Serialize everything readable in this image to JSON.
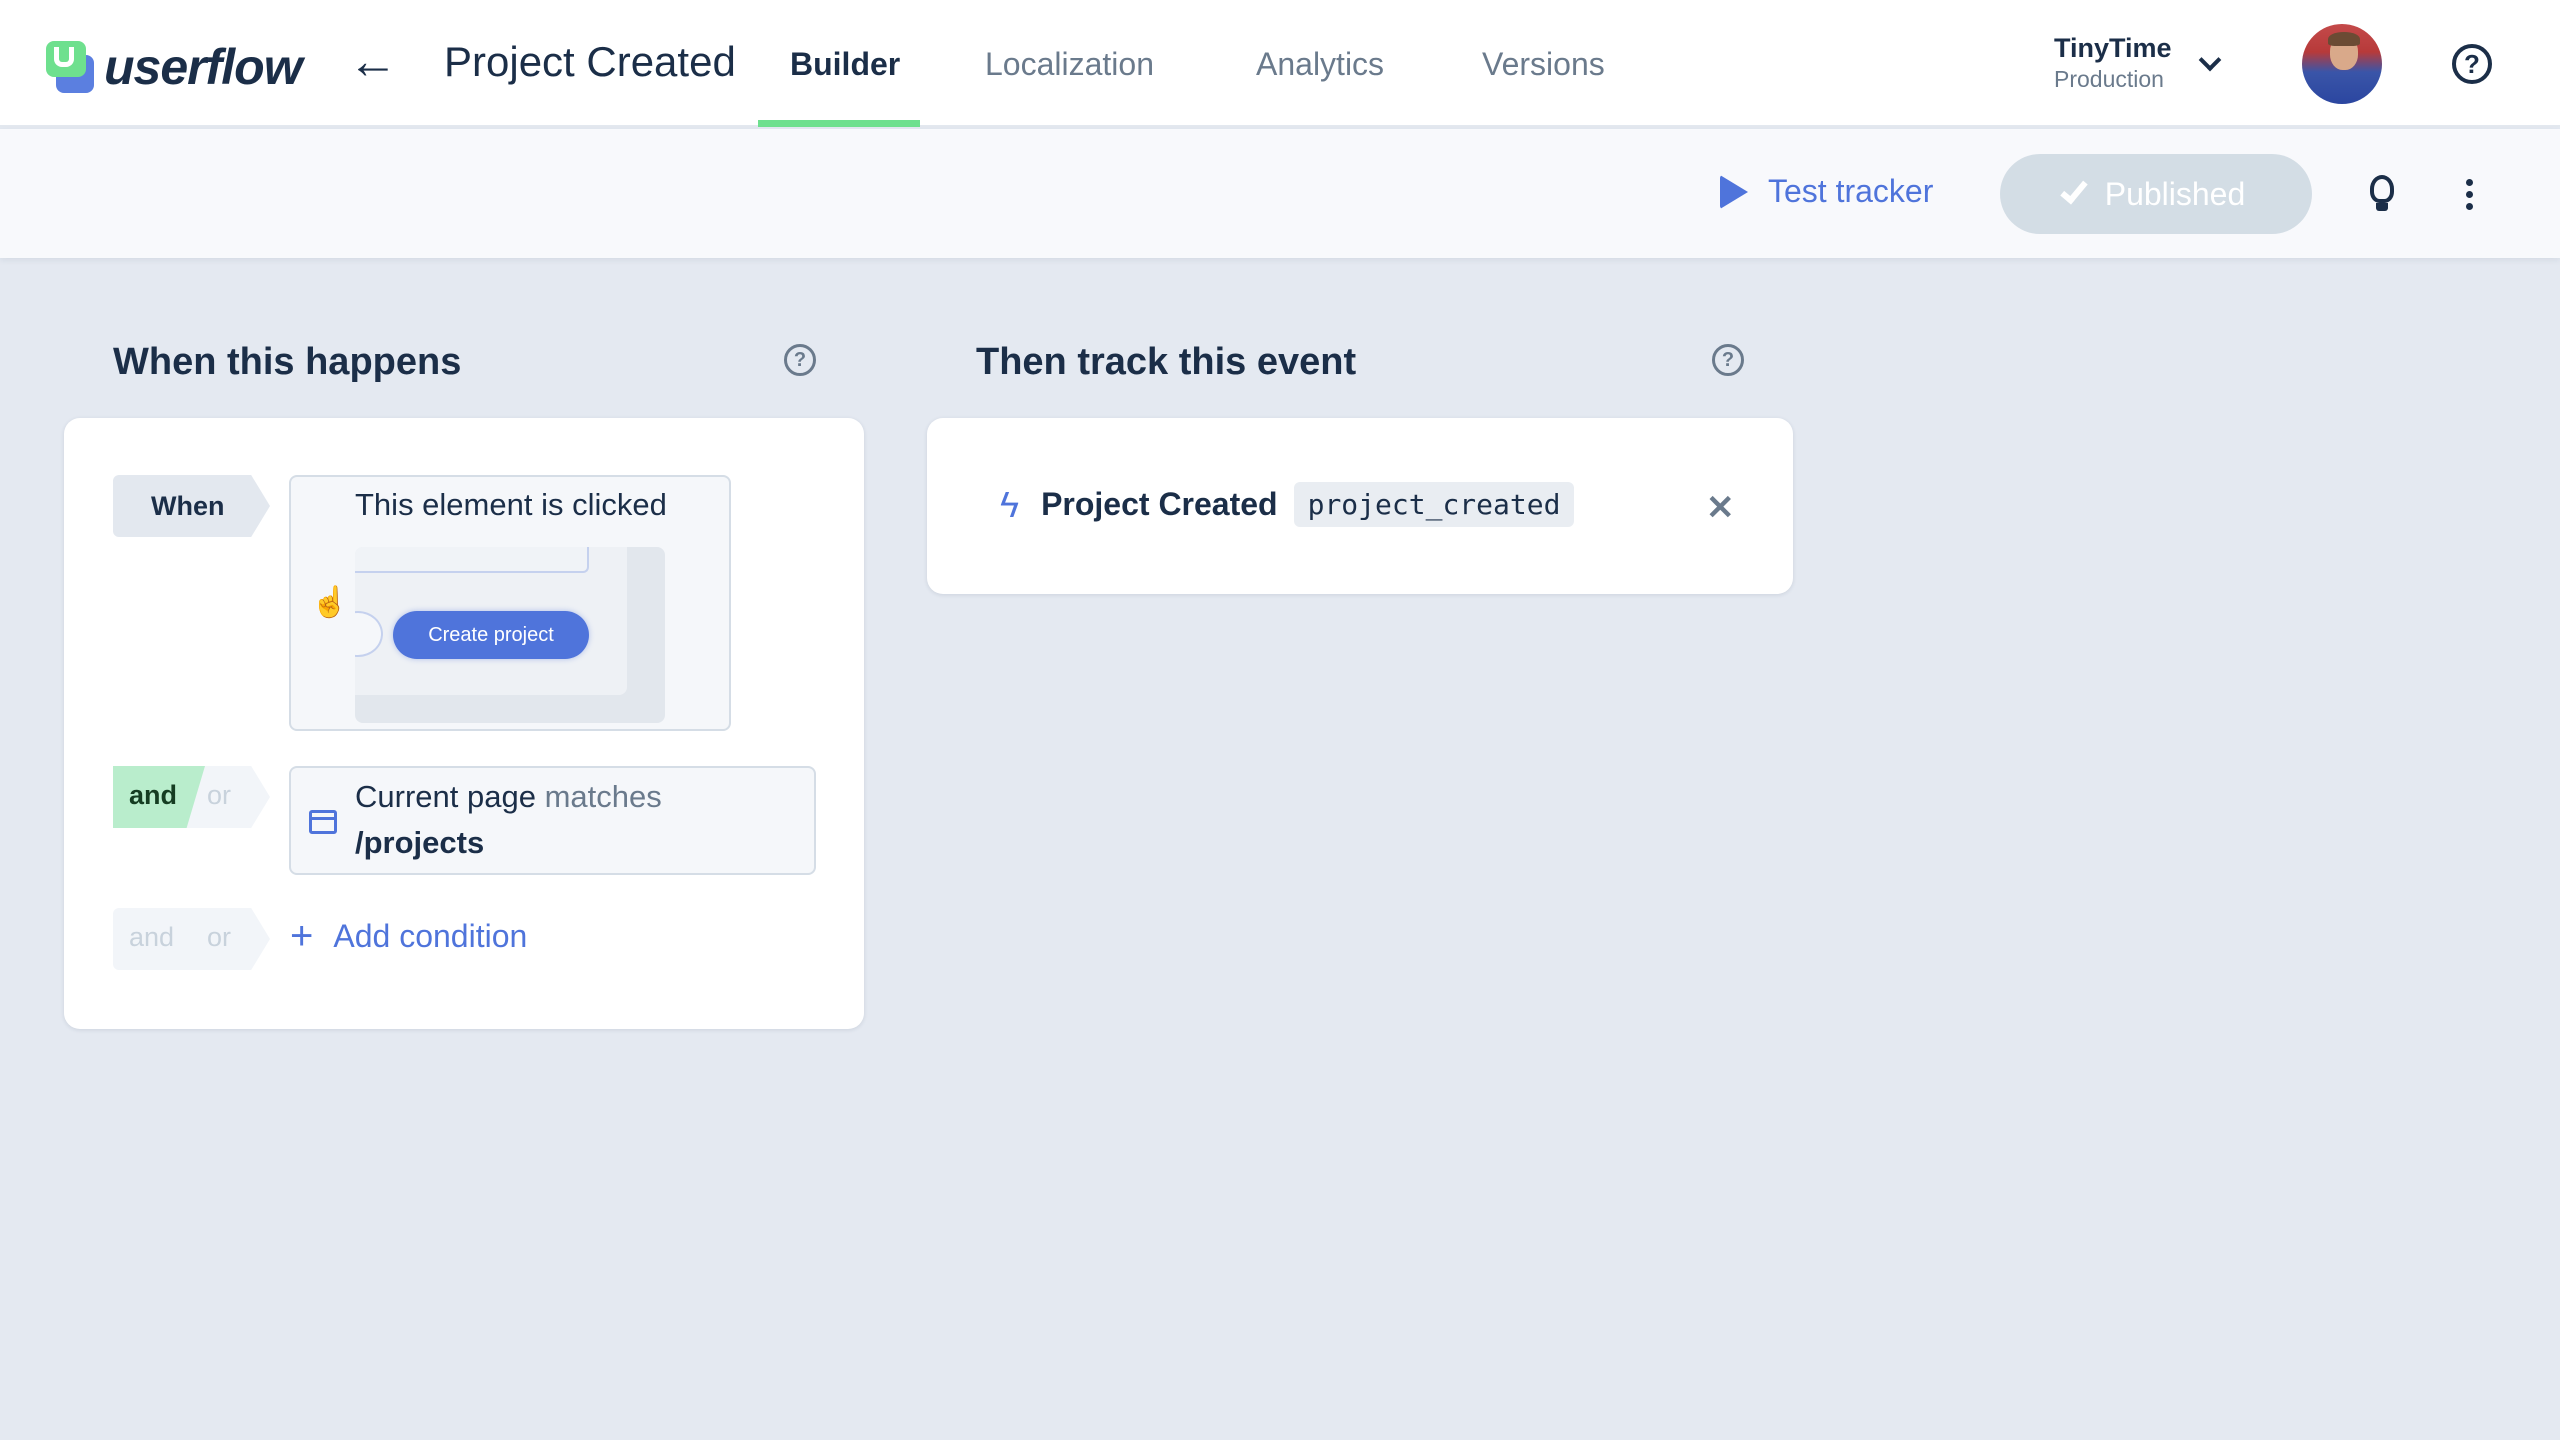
{
  "header": {
    "brand": "userflow",
    "back_icon": "arrow-left-icon",
    "flow_title": "Project Created",
    "tabs": [
      {
        "label": "Builder",
        "active": true
      },
      {
        "label": "Localization",
        "active": false
      },
      {
        "label": "Analytics",
        "active": false
      },
      {
        "label": "Versions",
        "active": false
      }
    ],
    "environment": {
      "name": "TinyTime",
      "stage": "Production"
    },
    "help_icon": "?"
  },
  "toolbar": {
    "test_label": "Test tracker",
    "published_label": "Published"
  },
  "trigger": {
    "title": "When this happens",
    "help_icon": "?",
    "when_label": "When",
    "element_condition": "This element is clicked",
    "element_preview_button": "Create project",
    "cursor_icon": "☝",
    "logic": {
      "and": "and",
      "or": "or",
      "selected": "and"
    },
    "page_condition": {
      "subject": "Current page",
      "operator": "matches",
      "value": "/projects"
    },
    "add_logic": {
      "and": "and",
      "or": "or"
    },
    "add_condition_label": "Add condition",
    "add_icon": "+"
  },
  "event": {
    "title": "Then track this event",
    "help_icon": "?",
    "name": "Project Created",
    "code": "project_created",
    "bolt_icon": "ϟ",
    "remove_icon": "✕"
  },
  "colors": {
    "accent": "#4f74db",
    "green": "#6ee08e",
    "text": "#1b2e48",
    "muted": "#6a7a8c",
    "published_bg": "#d3dde5"
  }
}
